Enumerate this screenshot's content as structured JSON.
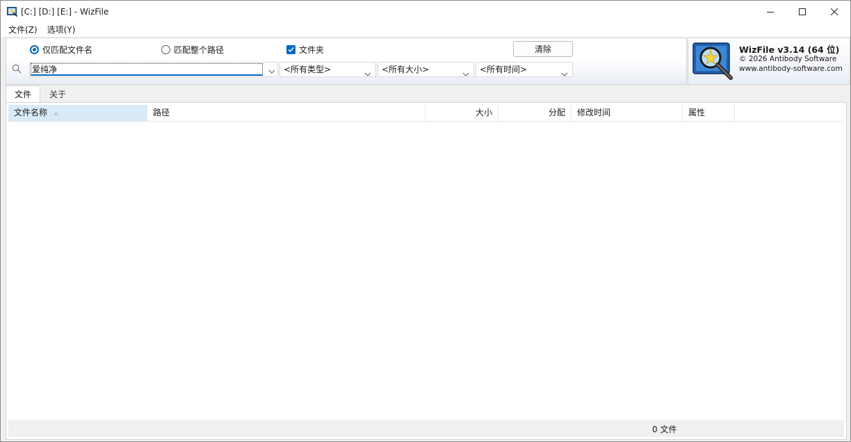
{
  "window": {
    "title": "[C:] [D:] [E:]  - WizFile",
    "controls": [
      "minimize",
      "maximize",
      "close"
    ]
  },
  "menu": {
    "items": [
      "文件(Z)",
      "选项(Y)"
    ]
  },
  "search": {
    "match_filename_label": "仅匹配文件名",
    "match_fullpath_label": "匹配整个路径",
    "folders_label": "文件夹",
    "clear_label": "清除",
    "query_value": "爱纯净",
    "type_filter": "<所有类型>",
    "size_filter": "<所有大小>",
    "time_filter": "<所有时间>",
    "selected_mode": "filename",
    "folders_checked": true
  },
  "branding": {
    "title": "WizFile v3.14 (64 位)",
    "copyright": "© 2026 Antibody Software",
    "website": "www.antibody-software.com"
  },
  "tabs": [
    {
      "label": "文件",
      "active": true
    },
    {
      "label": "关于",
      "active": false
    }
  ],
  "columns": {
    "name": "文件名称",
    "path": "路径",
    "size": "大小",
    "allocated": "分配",
    "modified": "修改时间",
    "attributes": "属性"
  },
  "status": {
    "file_count": "0 文件"
  },
  "colors": {
    "accent": "#0067c0",
    "sorted_column": "#d9ebf9"
  }
}
